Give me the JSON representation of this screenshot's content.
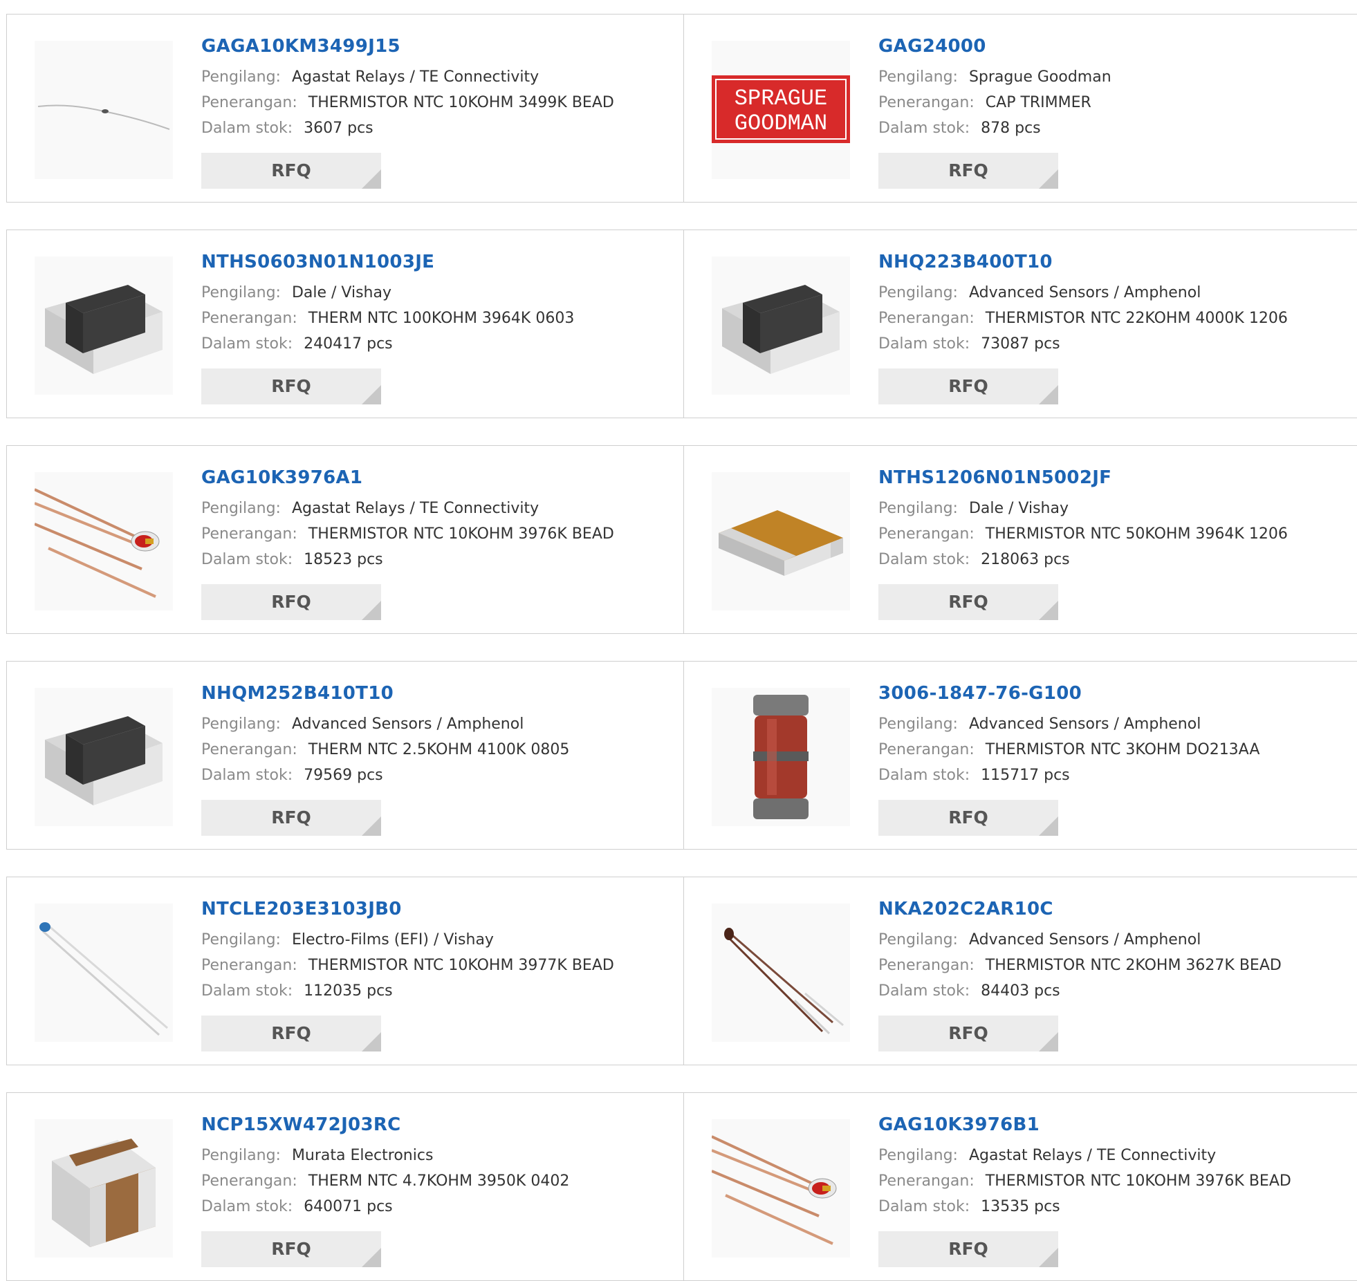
{
  "labels": {
    "manufacturer": "Pengilang:",
    "description": "Penerangan:",
    "stock": "Dalam stok:",
    "rfq": "RFQ"
  },
  "products": [
    {
      "pn": "GAGA10KM3499J15",
      "manufacturer": "Agastat Relays / TE Connectivity",
      "description": "THERMISTOR NTC 10KOHM 3499K BEAD",
      "stock": "3607 pcs",
      "image": "thin-wire-bead"
    },
    {
      "pn": "GAG24000",
      "manufacturer": "Sprague Goodman",
      "description": "CAP TRIMMER",
      "stock": "878 pcs",
      "image": "sprague-goodman-logo",
      "logo_lines": [
        "SPRAGUE",
        "GOODMAN"
      ]
    },
    {
      "pn": "NTHS0603N01N1003JE",
      "manufacturer": "Dale / Vishay",
      "description": "THERM NTC 100KOHM 3964K 0603",
      "stock": "240417 pcs",
      "image": "smd-chip-black"
    },
    {
      "pn": "NHQ223B400T10",
      "manufacturer": "Advanced Sensors / Amphenol",
      "description": "THERMISTOR NTC 22KOHM 4000K 1206",
      "stock": "73087 pcs",
      "image": "smd-chip-black"
    },
    {
      "pn": "GAG10K3976A1",
      "manufacturer": "Agastat Relays / TE Connectivity",
      "description": "THERMISTOR NTC 10KOHM 3976K BEAD",
      "stock": "18523 pcs",
      "image": "red-bead-leads"
    },
    {
      "pn": "NTHS1206N01N5002JF",
      "manufacturer": "Dale / Vishay",
      "description": "THERMISTOR NTC 50KOHM 3964K 1206",
      "stock": "218063 pcs",
      "image": "smd-chip-flat"
    },
    {
      "pn": "NHQM252B410T10",
      "manufacturer": "Advanced Sensors / Amphenol",
      "description": "THERM NTC 2.5KOHM 4100K 0805",
      "stock": "79569 pcs",
      "image": "smd-chip-black"
    },
    {
      "pn": "3006-1847-76-G100",
      "manufacturer": "Advanced Sensors / Amphenol",
      "description": "THERMISTOR NTC 3KOHM DO213AA",
      "stock": "115717 pcs",
      "image": "melf-glass"
    },
    {
      "pn": "NTCLE203E3103JB0",
      "manufacturer": "Electro-Films (EFI) / Vishay",
      "description": "THERMISTOR NTC 10KOHM 3977K BEAD",
      "stock": "112035 pcs",
      "image": "blue-bead-leads"
    },
    {
      "pn": "NKA202C2AR10C",
      "manufacturer": "Advanced Sensors / Amphenol",
      "description": "THERMISTOR NTC 2KOHM 3627K BEAD",
      "stock": "84403 pcs",
      "image": "brown-bead-leads"
    },
    {
      "pn": "NCP15XW472J03RC",
      "manufacturer": "Murata Electronics",
      "description": "THERM NTC 4.7KOHM 3950K 0402",
      "stock": "640071 pcs",
      "image": "smd-chip-brown"
    },
    {
      "pn": "GAG10K3976B1",
      "manufacturer": "Agastat Relays / TE Connectivity",
      "description": "THERMISTOR NTC 10KOHM 3976K BEAD",
      "stock": "13535 pcs",
      "image": "red-bead-leads"
    }
  ]
}
